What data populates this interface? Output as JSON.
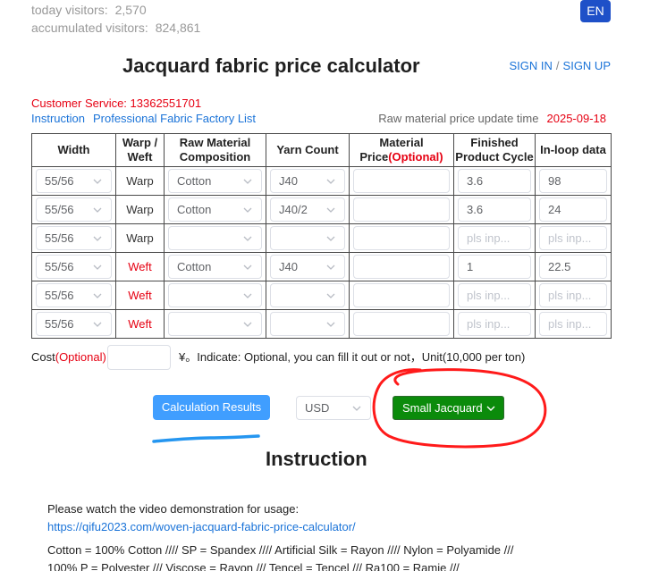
{
  "visitors": {
    "today_label": "today visitors:",
    "today_value": "2,570",
    "total_label": "accumulated visitors:",
    "total_value": "824,861"
  },
  "language_button": "EN",
  "title": "Jacquard fabric price calculator",
  "auth": {
    "sign_in": "SIGN IN",
    "separator": "/",
    "sign_up": "SIGN UP"
  },
  "customer_service": "Customer Service: 13362551701",
  "links": {
    "instruction": "Instruction",
    "factory_list": "Professional Fabric Factory List"
  },
  "price_update": {
    "label": "Raw material price update time",
    "date": "2025-09-18"
  },
  "table": {
    "headers": {
      "width": "Width",
      "warp_weft": [
        "Warp /",
        "Weft"
      ],
      "composition": [
        "Raw Material",
        "Composition"
      ],
      "yarn_count": "Yarn Count",
      "price": [
        "Material",
        "Price"
      ],
      "price_optional": "(Optional)",
      "cycle": [
        "Finished",
        "Product Cycle"
      ],
      "inloop": "In-loop data"
    },
    "placeholder": "pls inp...",
    "rows": [
      {
        "width": "55/56",
        "type": "Warp",
        "composition": "Cotton",
        "yarn_count": "J40",
        "price": "",
        "cycle": "3.6",
        "inloop": "98"
      },
      {
        "width": "55/56",
        "type": "Warp",
        "composition": "Cotton",
        "yarn_count": "J40/2",
        "price": "",
        "cycle": "3.6",
        "inloop": "24"
      },
      {
        "width": "55/56",
        "type": "Warp",
        "composition": "",
        "yarn_count": "",
        "price": "",
        "cycle": "",
        "inloop": ""
      },
      {
        "width": "55/56",
        "type": "Weft",
        "composition": "Cotton",
        "yarn_count": "J40",
        "price": "",
        "cycle": "1",
        "inloop": "22.5"
      },
      {
        "width": "55/56",
        "type": "Weft",
        "composition": "",
        "yarn_count": "",
        "price": "",
        "cycle": "",
        "inloop": ""
      },
      {
        "width": "55/56",
        "type": "Weft",
        "composition": "",
        "yarn_count": "",
        "price": "",
        "cycle": "",
        "inloop": ""
      }
    ]
  },
  "cost": {
    "label": "Cost",
    "optional": "(Optional)",
    "value": "",
    "note": "¥。Indicate: Optional, you can fill it out or not，Unit(10,000 per ton)"
  },
  "actions": {
    "calculate": "Calculation Results",
    "currency": "USD",
    "fabric_type": "Small Jacquard"
  },
  "instruction": {
    "heading": "Instruction",
    "video_text": "Please watch the video demonstration for usage:",
    "video_link": "https://qifu2023.com/woven-jacquard-fabric-price-calculator/",
    "abbreviations": [
      "Cotton = 100% Cotton //// SP = Spandex //// Artificial Silk = Rayon //// Nylon = Polyamide ///",
      "100% P = Polyester /// Viscose = Rayon /// Tencel = Tencel /// Ra100 = Ramie ///"
    ]
  },
  "icons": {
    "select_arrow": "chevron-down-icon"
  },
  "colors": {
    "primary": "#409eff",
    "brand": "#1e50c8",
    "green": "#0b8b0b",
    "green_border": "#2d6a2d",
    "red": "#e60012",
    "link": "#1a73d8",
    "annotation_red": "#ff1a1a",
    "annotation_blue": "#2596f0"
  }
}
